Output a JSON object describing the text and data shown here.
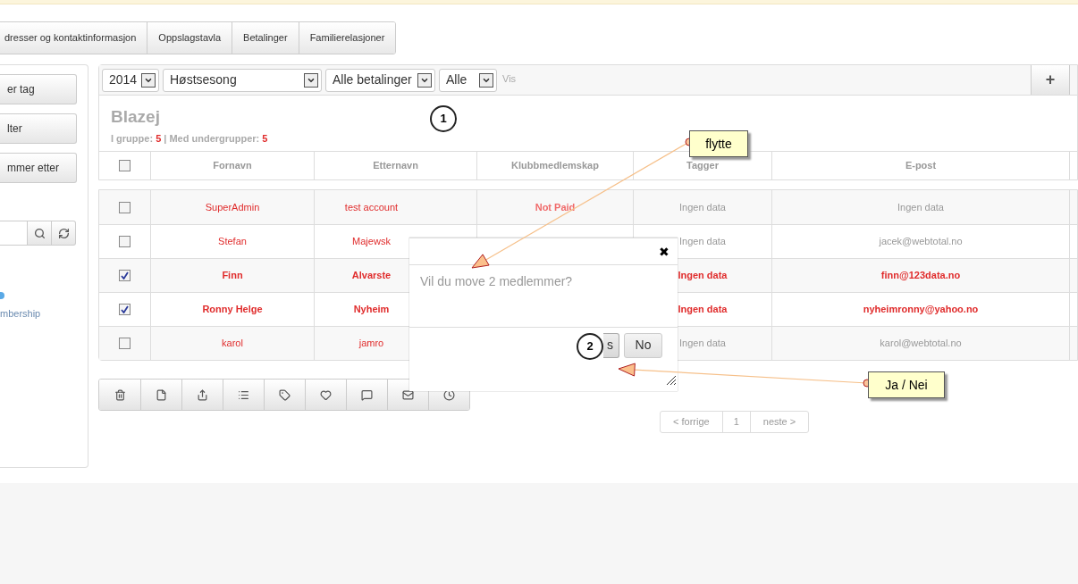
{
  "tabs": [
    {
      "label": "dresser og kontaktinformasjon"
    },
    {
      "label": "Oppslagstavla"
    },
    {
      "label": "Betalinger"
    },
    {
      "label": "Familierelasjoner"
    }
  ],
  "sidebar": {
    "buttons": [
      "er tag",
      "lter",
      "mmer etter"
    ],
    "legend": {
      "color": "#5aa9e6",
      "label": "mbership"
    }
  },
  "filters": [
    {
      "value": "2014"
    },
    {
      "value": "Høstsesong"
    },
    {
      "value": "Alle betalinger"
    },
    {
      "value": "Alle"
    }
  ],
  "filter_button": "Vis",
  "add_button": "+",
  "group": {
    "title": "Blazej",
    "in_group_label": "I gruppe:",
    "in_group_count": "5",
    "separator": "|",
    "sub_label": "Med undergrupper:",
    "sub_count": "5"
  },
  "table": {
    "select_all": false,
    "columns": [
      "Fornavn",
      "Etternavn",
      "Klubbmedlemskap",
      "Tagger",
      "E-post"
    ],
    "rows": [
      {
        "selected": false,
        "first": "SuperAdmin",
        "last": "test account",
        "membership": {
          "text": "Not Paid",
          "color": "#f06a6a"
        },
        "tags": "Ingen data",
        "email": "Ingen data"
      },
      {
        "selected": false,
        "first": "Stefan",
        "last": "Majewsk",
        "tags": "Ingen data",
        "email": "jacek@webtotal.no"
      },
      {
        "selected": true,
        "first": "Finn",
        "last": "Alvarste",
        "tags": "Ingen data",
        "email": "finn@123data.no"
      },
      {
        "selected": true,
        "first": "Ronny Helge",
        "last": "Nyheim",
        "tags": "Ingen data",
        "email": "nyheimronny@yahoo.no"
      },
      {
        "selected": false,
        "first": "karol",
        "last": "jamro",
        "tags": "Ingen data",
        "email": "karol@webtotal.no"
      }
    ]
  },
  "pagination": {
    "prev": "< forrige",
    "page": "1",
    "next": "neste >"
  },
  "dialog": {
    "close": "✖",
    "message": "Vil du move 2 medlemmer?",
    "yes": "s",
    "no": "No"
  },
  "annotations": [
    {
      "kind": "marker",
      "number": "1"
    },
    {
      "kind": "marker",
      "number": "2"
    },
    {
      "kind": "note",
      "text": "flytte"
    },
    {
      "kind": "note",
      "text": "Ja / Nei"
    }
  ]
}
